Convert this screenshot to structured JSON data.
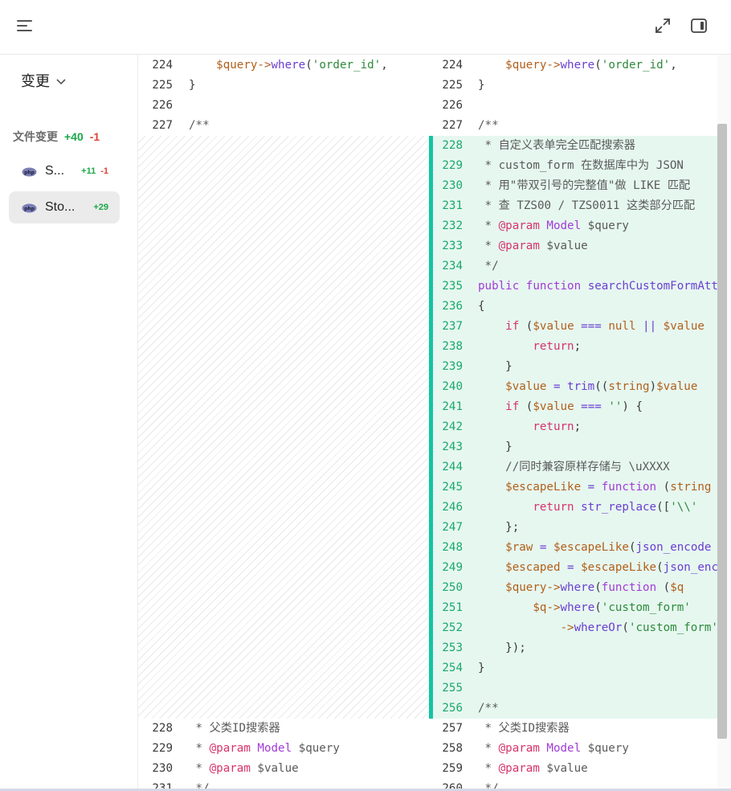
{
  "header": {
    "menu_icon": "menu-lines-icon",
    "expand_icon": "expand-arrows-icon",
    "panel_icon": "sidebar-panel-icon"
  },
  "sidebar": {
    "dropdown_label": "变更",
    "file_changes_label": "文件变更",
    "total_added": "+40",
    "total_removed": "-1",
    "files": [
      {
        "name": "S...",
        "added": "+11",
        "removed": "-1",
        "active": false
      },
      {
        "name": "Sto...",
        "added": "+29",
        "removed": "",
        "active": true
      }
    ]
  },
  "diff": {
    "left_rows": [
      {
        "ln": "224",
        "tokens": [
          [
            "    ",
            ""
          ],
          [
            "$query",
            "var"
          ],
          [
            "->",
            "var"
          ],
          [
            "where",
            "fn"
          ],
          [
            "(",
            ""
          ],
          [
            "'order_id'",
            "str"
          ],
          [
            ",",
            ""
          ]
        ]
      },
      {
        "ln": "225",
        "tokens": [
          [
            "}",
            ""
          ]
        ]
      },
      {
        "ln": "226",
        "tokens": []
      },
      {
        "ln": "227",
        "tokens": [
          [
            "/**",
            "cm"
          ]
        ]
      },
      {
        "ln": "228",
        "tokens": [
          [
            " * 父类ID搜索器",
            "cm"
          ]
        ]
      },
      {
        "ln": "229",
        "tokens": [
          [
            " * ",
            "cm"
          ],
          [
            "@param",
            "tag"
          ],
          [
            " ",
            ""
          ],
          [
            "Model",
            "kw"
          ],
          [
            " $query",
            "cm"
          ]
        ]
      },
      {
        "ln": "230",
        "tokens": [
          [
            " * ",
            "cm"
          ],
          [
            "@param",
            "tag"
          ],
          [
            " $value",
            "cm"
          ]
        ]
      },
      {
        "ln": "231",
        "tokens": [
          [
            " */",
            "cm"
          ]
        ]
      }
    ],
    "right_rows": [
      {
        "ln": "224",
        "tokens": [
          [
            "    ",
            ""
          ],
          [
            "$query",
            "var"
          ],
          [
            "->",
            "var"
          ],
          [
            "where",
            "fn"
          ],
          [
            "(",
            ""
          ],
          [
            "'order_id'",
            "str"
          ],
          [
            ",",
            ""
          ]
        ]
      },
      {
        "ln": "225",
        "tokens": [
          [
            "}",
            ""
          ]
        ]
      },
      {
        "ln": "226",
        "tokens": []
      },
      {
        "ln": "227",
        "tokens": [
          [
            "/**",
            "cm"
          ]
        ]
      },
      {
        "ln": "228",
        "tokens": [
          [
            " * 自定义表单完全匹配搜索器",
            "cm"
          ]
        ],
        "added": true
      },
      {
        "ln": "229",
        "tokens": [
          [
            " * custom_form 在数据库中为 JSON",
            "cm"
          ]
        ],
        "added": true
      },
      {
        "ln": "230",
        "tokens": [
          [
            " * 用\"带双引号的完整值\"做 LIKE 匹配",
            "cm"
          ]
        ],
        "added": true
      },
      {
        "ln": "231",
        "tokens": [
          [
            " * 查 TZS00 / TZS0011 这类部分匹配",
            "cm"
          ]
        ],
        "added": true
      },
      {
        "ln": "232",
        "tokens": [
          [
            " * ",
            "cm"
          ],
          [
            "@param",
            "tag"
          ],
          [
            " ",
            ""
          ],
          [
            "Model",
            "kw"
          ],
          [
            " $query",
            "cm"
          ]
        ],
        "added": true
      },
      {
        "ln": "233",
        "tokens": [
          [
            " * ",
            "cm"
          ],
          [
            "@param",
            "tag"
          ],
          [
            " $value",
            "cm"
          ]
        ],
        "added": true
      },
      {
        "ln": "234",
        "tokens": [
          [
            " */",
            "cm"
          ]
        ],
        "added": true
      },
      {
        "ln": "235",
        "tokens": [
          [
            "public",
            "kw"
          ],
          [
            " ",
            ""
          ],
          [
            "function",
            "kw"
          ],
          [
            " ",
            ""
          ],
          [
            "searchCustomFormAttr",
            "fn"
          ]
        ],
        "added": true
      },
      {
        "ln": "236",
        "tokens": [
          [
            "{",
            ""
          ]
        ],
        "added": true
      },
      {
        "ln": "237",
        "tokens": [
          [
            "    ",
            ""
          ],
          [
            "if",
            "kw2"
          ],
          [
            " (",
            ""
          ],
          [
            "$value",
            "var"
          ],
          [
            " === ",
            "fn"
          ],
          [
            "null",
            "var"
          ],
          [
            " || ",
            "fn"
          ],
          [
            "$value",
            "var"
          ]
        ],
        "added": true
      },
      {
        "ln": "238",
        "tokens": [
          [
            "        ",
            ""
          ],
          [
            "return",
            "kw2"
          ],
          [
            ";",
            ""
          ]
        ],
        "added": true
      },
      {
        "ln": "239",
        "tokens": [
          [
            "    }",
            ""
          ]
        ],
        "added": true
      },
      {
        "ln": "240",
        "tokens": [
          [
            "    ",
            ""
          ],
          [
            "$value",
            "var"
          ],
          [
            " = ",
            "fn"
          ],
          [
            "trim",
            "fn"
          ],
          [
            "((",
            ""
          ],
          [
            "string",
            "var"
          ],
          [
            ")",
            ""
          ],
          [
            "$value",
            "var"
          ]
        ],
        "added": true
      },
      {
        "ln": "241",
        "tokens": [
          [
            "    ",
            ""
          ],
          [
            "if",
            "kw2"
          ],
          [
            " (",
            ""
          ],
          [
            "$value",
            "var"
          ],
          [
            " === ",
            "fn"
          ],
          [
            "''",
            "str"
          ],
          [
            ") {",
            ""
          ]
        ],
        "added": true
      },
      {
        "ln": "242",
        "tokens": [
          [
            "        ",
            ""
          ],
          [
            "return",
            "kw2"
          ],
          [
            ";",
            ""
          ]
        ],
        "added": true
      },
      {
        "ln": "243",
        "tokens": [
          [
            "    }",
            ""
          ]
        ],
        "added": true
      },
      {
        "ln": "244",
        "tokens": [
          [
            "    //同时兼容原样存储与 \\uXXXX",
            "cm"
          ]
        ],
        "added": true
      },
      {
        "ln": "245",
        "tokens": [
          [
            "    ",
            ""
          ],
          [
            "$escapeLike",
            "var"
          ],
          [
            " = ",
            "fn"
          ],
          [
            "function",
            "kw"
          ],
          [
            " (",
            ""
          ],
          [
            "string",
            "var"
          ]
        ],
        "added": true
      },
      {
        "ln": "246",
        "tokens": [
          [
            "        ",
            ""
          ],
          [
            "return",
            "kw2"
          ],
          [
            " ",
            ""
          ],
          [
            "str_replace",
            "fn"
          ],
          [
            "([",
            ""
          ],
          [
            "'\\\\'",
            "str"
          ]
        ],
        "added": true
      },
      {
        "ln": "247",
        "tokens": [
          [
            "    };",
            ""
          ]
        ],
        "added": true
      },
      {
        "ln": "248",
        "tokens": [
          [
            "    ",
            ""
          ],
          [
            "$raw",
            "var"
          ],
          [
            " = ",
            "fn"
          ],
          [
            "$escapeLike",
            "var"
          ],
          [
            "(",
            ""
          ],
          [
            "json_encode",
            "fn"
          ]
        ],
        "added": true
      },
      {
        "ln": "249",
        "tokens": [
          [
            "    ",
            ""
          ],
          [
            "$escaped",
            "var"
          ],
          [
            " = ",
            "fn"
          ],
          [
            "$escapeLike",
            "var"
          ],
          [
            "(",
            ""
          ],
          [
            "json_encode",
            "fn"
          ]
        ],
        "added": true
      },
      {
        "ln": "250",
        "tokens": [
          [
            "    ",
            ""
          ],
          [
            "$query",
            "var"
          ],
          [
            "->",
            "var"
          ],
          [
            "where",
            "fn"
          ],
          [
            "(",
            ""
          ],
          [
            "function",
            "kw"
          ],
          [
            " (",
            ""
          ],
          [
            "$q",
            "var"
          ]
        ],
        "added": true
      },
      {
        "ln": "251",
        "tokens": [
          [
            "        ",
            ""
          ],
          [
            "$q",
            "var"
          ],
          [
            "->",
            "var"
          ],
          [
            "where",
            "fn"
          ],
          [
            "(",
            ""
          ],
          [
            "'custom_form'",
            "str"
          ]
        ],
        "added": true
      },
      {
        "ln": "252",
        "tokens": [
          [
            "            ",
            ""
          ],
          [
            "->",
            "var"
          ],
          [
            "whereOr",
            "fn"
          ],
          [
            "(",
            ""
          ],
          [
            "'custom_form'",
            "str"
          ]
        ],
        "added": true
      },
      {
        "ln": "253",
        "tokens": [
          [
            "    });",
            ""
          ]
        ],
        "added": true
      },
      {
        "ln": "254",
        "tokens": [
          [
            "}",
            ""
          ]
        ],
        "added": true
      },
      {
        "ln": "255",
        "tokens": [],
        "added": true
      },
      {
        "ln": "256",
        "tokens": [
          [
            "/**",
            "cm"
          ]
        ],
        "added": true
      },
      {
        "ln": "257",
        "tokens": [
          [
            " * 父类ID搜索器",
            "cm"
          ]
        ]
      },
      {
        "ln": "258",
        "tokens": [
          [
            " * ",
            "cm"
          ],
          [
            "@param",
            "tag"
          ],
          [
            " ",
            ""
          ],
          [
            "Model",
            "kw"
          ],
          [
            " $query",
            "cm"
          ]
        ]
      },
      {
        "ln": "259",
        "tokens": [
          [
            " * ",
            "cm"
          ],
          [
            "@param",
            "tag"
          ],
          [
            " $value",
            "cm"
          ]
        ]
      },
      {
        "ln": "260",
        "tokens": [
          [
            " */",
            "cm"
          ]
        ]
      }
    ]
  }
}
